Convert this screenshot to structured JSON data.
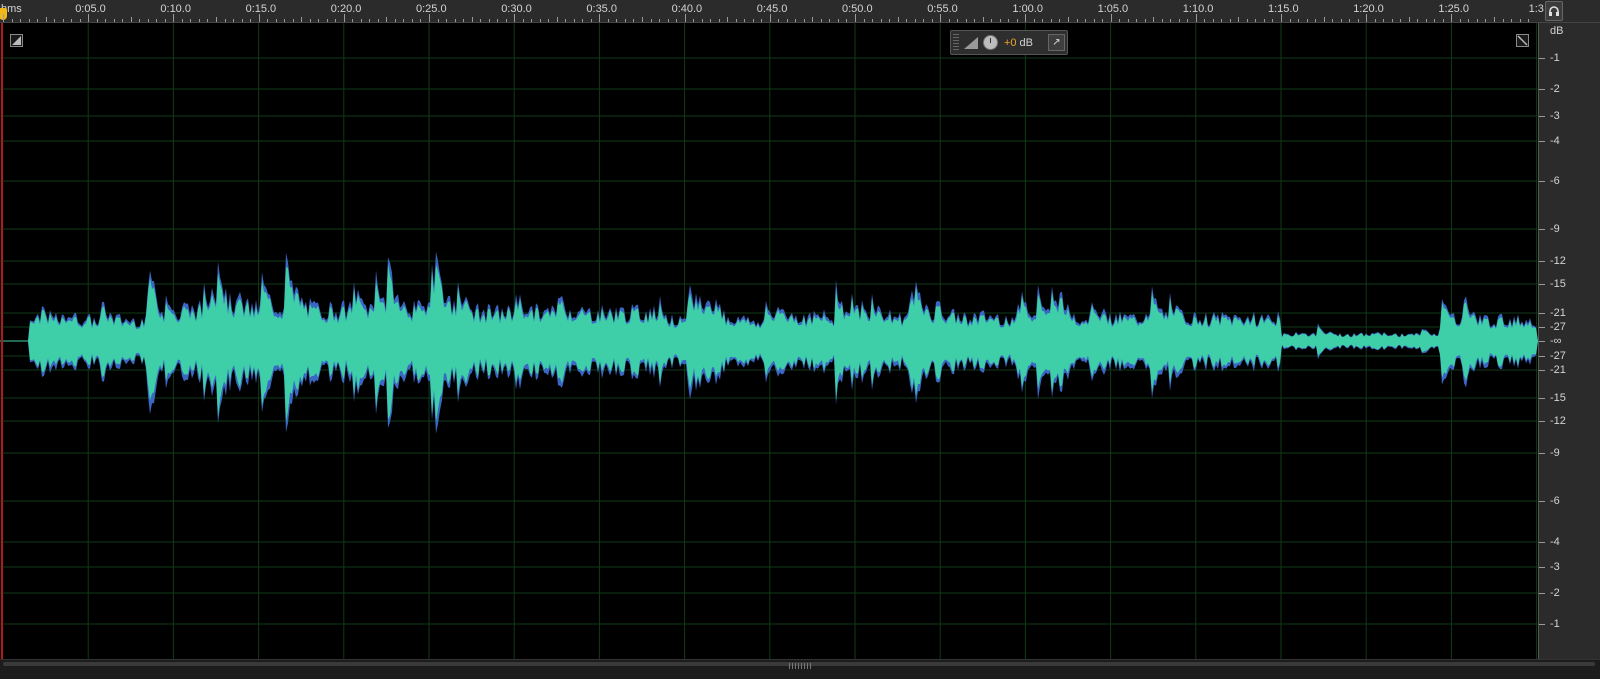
{
  "ruler": {
    "unit_label": "hms",
    "labels": [
      "0:05.0",
      "0:10.0",
      "0:15.0",
      "0:20.0",
      "0:25.0",
      "0:30.0",
      "0:35.0",
      "0:40.0",
      "0:45.0",
      "0:50.0",
      "0:55.0",
      "1:00.0",
      "1:05.0",
      "1:10.0",
      "1:15.0",
      "1:20.0",
      "1:25.0",
      "1:3"
    ]
  },
  "hud": {
    "value": "+0",
    "unit": "dB"
  },
  "db_scale": {
    "unit": "dB",
    "top_labels": [
      "-1",
      "-2",
      "-3",
      "-4",
      "-6",
      "-9",
      "-12",
      "-15",
      "-21",
      "-27"
    ],
    "center_label": "-∞",
    "bottom_labels": [
      "-27",
      "-21",
      "-15",
      "-12",
      "-9",
      "-6",
      "-4",
      "-3",
      "-2",
      "-1"
    ]
  },
  "colors": {
    "waveform_fill": "#3ecfa8",
    "waveform_edge": "#3a66c4",
    "grid_line": "#0f3a17",
    "playhead": "#b01a1a",
    "ruler_bg": "#2b2b2b",
    "hud_accent": "#e8a427"
  },
  "icons": {
    "headphone": "headphone-icon",
    "hud_pin": "pin-icon",
    "corner_left": "collapse-left-icon",
    "corner_right": "collapse-right-icon"
  }
}
